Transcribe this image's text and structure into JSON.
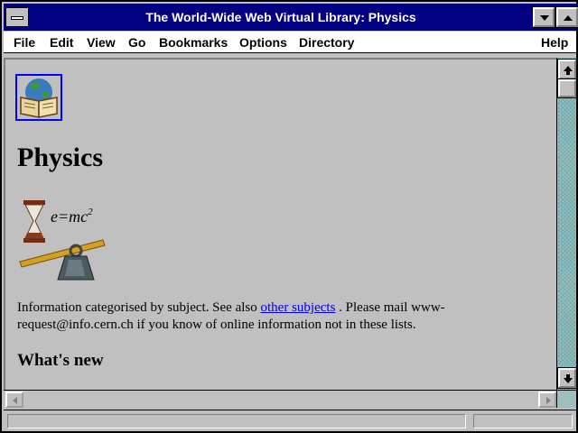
{
  "window": {
    "title": "The World-Wide Web Virtual Library: Physics"
  },
  "menubar": {
    "items": [
      {
        "label": "File"
      },
      {
        "label": "Edit"
      },
      {
        "label": "View"
      },
      {
        "label": "Go"
      },
      {
        "label": "Bookmarks"
      },
      {
        "label": "Options"
      },
      {
        "label": "Directory"
      },
      {
        "label": "Help"
      }
    ]
  },
  "page": {
    "heading": "Physics",
    "equation": {
      "base": "e=mc",
      "exponent": "2"
    },
    "intro": {
      "before_link": "Information categorised by subject. See also ",
      "link_text": "other subjects",
      "after_link": " . Please mail www-request@info.cern.ch if you know of online information not in these lists."
    },
    "section_heading": "What's new"
  },
  "colors": {
    "titlebar": "#000080",
    "link": "#0000ee",
    "background": "#c0c0c0"
  }
}
